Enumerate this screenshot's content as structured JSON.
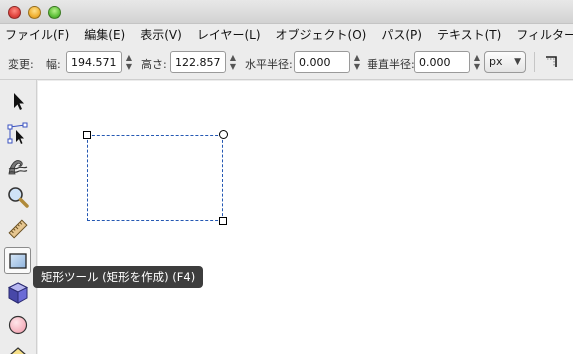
{
  "window": {
    "buttons": [
      "close",
      "minimize",
      "zoom"
    ]
  },
  "menu": [
    "ファイル(F)",
    "編集(E)",
    "表示(V)",
    "レイヤー(L)",
    "オブジェクト(O)",
    "パス(P)",
    "テキスト(T)",
    "フィルター(S)"
  ],
  "controls": {
    "transform_label": "変更:",
    "width_label": "幅:",
    "width_value": "194.571",
    "height_label": "高さ:",
    "height_value": "122.857",
    "rx_label": "水平半径:",
    "rx_value": "0.000",
    "ry_label": "垂直半径:",
    "ry_value": "0.000",
    "unit": "px"
  },
  "tools": [
    {
      "name": "selector-arrow-icon",
      "active": false
    },
    {
      "name": "node-editor-icon",
      "active": false
    },
    {
      "name": "tweak-wave-icon",
      "active": false
    },
    {
      "name": "zoom-magnifier-icon",
      "active": false
    },
    {
      "name": "measure-ruler-icon",
      "active": false
    },
    {
      "name": "rectangle-tool-icon",
      "active": true
    },
    {
      "name": "3d-box-icon",
      "active": false
    },
    {
      "name": "ellipse-circle-icon",
      "active": false
    },
    {
      "name": "star-polygon-icon",
      "active": false
    }
  ],
  "tooltip": "矩形ツール (矩形を作成) (F4)",
  "colors": {
    "selection_dash": "#2458b3",
    "tooltip_bg": "#3d3d3d"
  }
}
